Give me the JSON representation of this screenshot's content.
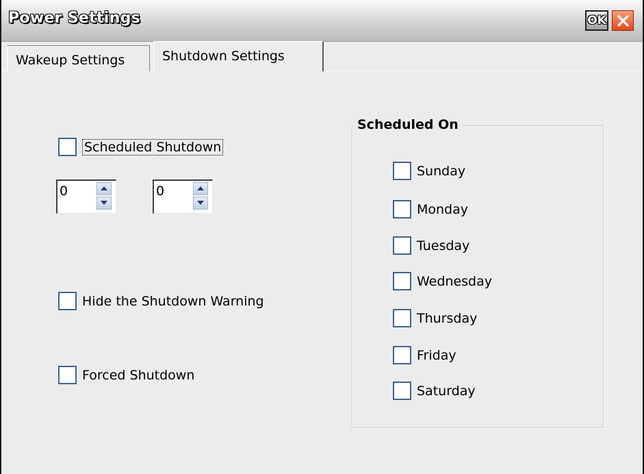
{
  "window": {
    "title": "Power Settings",
    "ok_label": "OK"
  },
  "tabs": [
    {
      "label": "Wakeup Settings",
      "active": false
    },
    {
      "label": "Shutdown Settings",
      "active": true
    }
  ],
  "shutdown": {
    "scheduled_shutdown_label": "Scheduled Shutdown",
    "scheduled_shutdown_checked": false,
    "hour_value": "0",
    "minute_value": "0",
    "hide_warning_label": "Hide the Shutdown Warning",
    "hide_warning_checked": false,
    "forced_shutdown_label": "Forced Shutdown",
    "forced_shutdown_checked": false
  },
  "scheduled_on": {
    "title": "Scheduled On",
    "days": [
      "Sunday",
      "Monday",
      "Tuesday",
      "Wednesday",
      "Thursday",
      "Friday",
      "Saturday"
    ]
  },
  "icons": {
    "close": "close-x-icon",
    "spin_up": "spin-up-arrow-icon",
    "spin_down": "spin-down-arrow-icon"
  },
  "colors": {
    "close_button": "#e44a1c",
    "checkbox_border": "#42648c",
    "window_bg": "#ececec"
  }
}
